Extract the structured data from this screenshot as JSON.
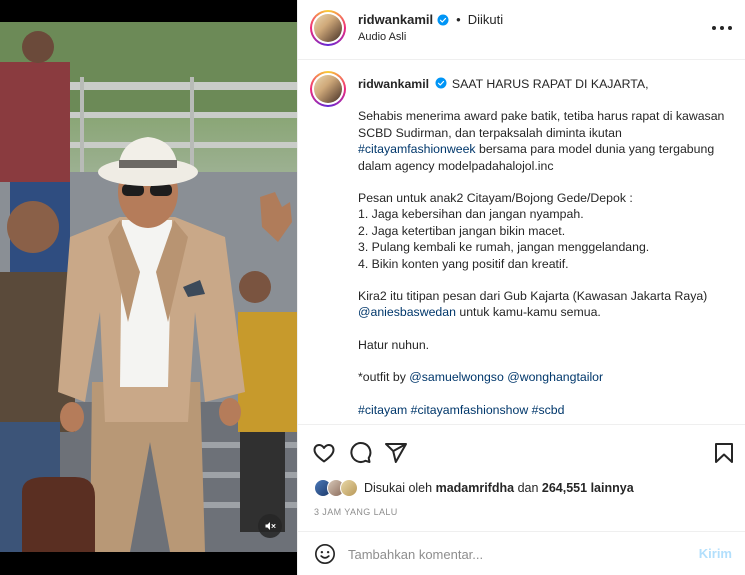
{
  "header": {
    "username": "ridwankamil",
    "follow_status": "Diikuti",
    "audio": "Audio Asli",
    "separator": "•"
  },
  "caption": {
    "username": "ridwankamil",
    "title": "SAAT HARUS RAPAT DI KAJARTA,",
    "p1_a": "Sehabis menerima award pake batik, tetiba harus rapat di kawasan SCBD Sudirman, dan terpaksalah diminta ikutan",
    "p1_tag": "#citayamfashionweek",
    "p1_b": "bersama para model dunia yang tergabung dalam agency modelpadahalojol.inc",
    "p2_intro": "Pesan untuk anak2 Citayam/Bojong Gede/Depok :",
    "p2_items": [
      "1. Jaga kebersihan dan jangan nyampah.",
      "2. Jaga ketertiban jangan bikin macet.",
      "3. Pulang kembali ke rumah, jangan menggelandang.",
      "4. Bikin konten yang positif dan kreatif."
    ],
    "p3_a": "Kira2 itu titipan pesan dari Gub Kajarta (Kawasan Jakarta Raya)",
    "p3_tag": "@aniesbaswedan",
    "p3_b": "untuk kamu-kamu semua.",
    "p4": "Hatur nuhun.",
    "p5_a": "*outfit by",
    "p5_tag1": "@samuelwongso",
    "p5_tag2": "@wonghangtailor",
    "p6_tags": [
      "#citayam",
      "#citayamfashionshow",
      "#scbd"
    ]
  },
  "likes": {
    "prefix": "Disukai oleh",
    "user": "madamrifdha",
    "middle": "dan",
    "count": "264,551",
    "suffix": "lainnya"
  },
  "time": "3 JAM YANG LALU",
  "comment": {
    "placeholder": "Tambahkan komentar...",
    "send": "Kirim"
  },
  "icons": {
    "more": "more-options-icon",
    "like": "heart-icon",
    "comment": "comment-icon",
    "share": "share-icon",
    "save": "bookmark-icon",
    "emoji": "emoji-icon",
    "mute": "muted-speaker-icon",
    "verified": "verified-badge-icon"
  },
  "colors": {
    "link": "#00376b",
    "verified": "#0095f6",
    "send_disabled": "#b2dffc",
    "muted_text": "#8e8e8e"
  }
}
